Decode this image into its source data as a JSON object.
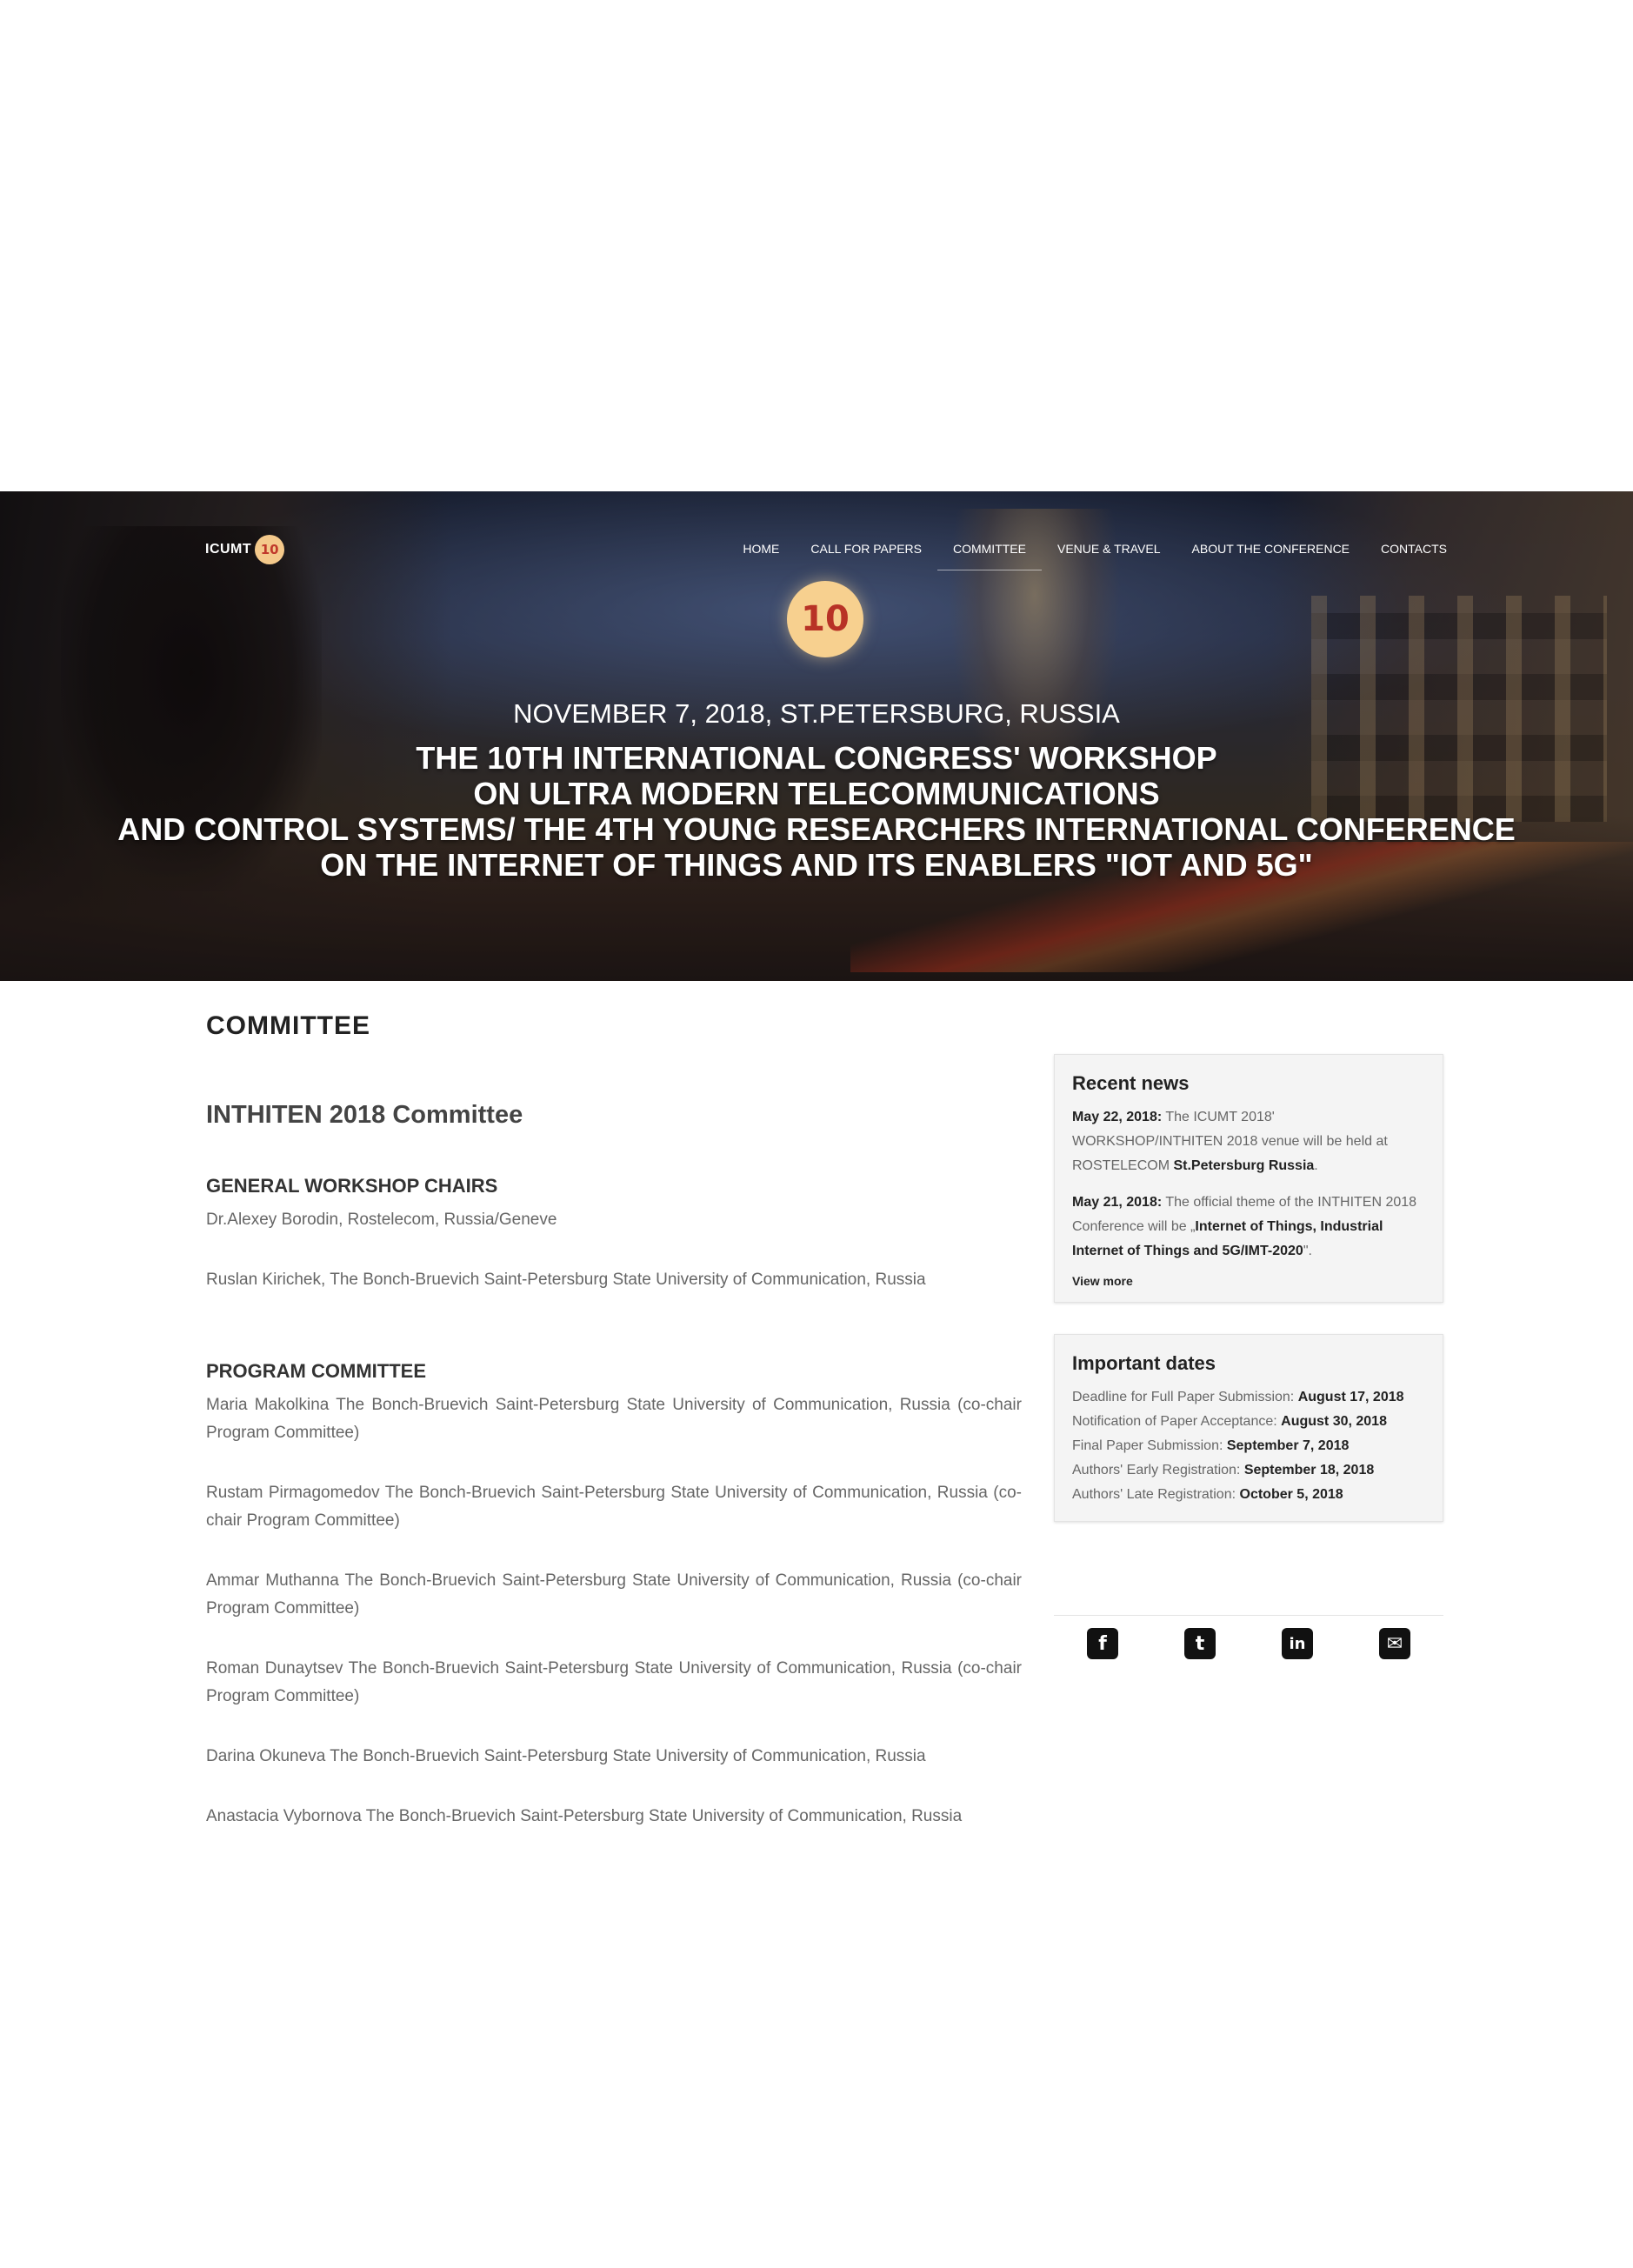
{
  "header": {
    "logo_text": "ICUMT",
    "logo_badge": "10",
    "nav": [
      {
        "label": "HOME"
      },
      {
        "label": "CALL FOR PAPERS"
      },
      {
        "label": "COMMITTEE"
      },
      {
        "label": "VENUE & TRAVEL"
      },
      {
        "label": "ABOUT THE CONFERENCE"
      },
      {
        "label": "CONTACTS"
      }
    ],
    "active_nav": "COMMITTEE"
  },
  "hero": {
    "badge": "10",
    "date": "NOVEMBER 7, 2018, ST.PETERSBURG, RUSSIA",
    "title_lines": [
      "THE 10TH INTERNATIONAL CONGRESS' WORKSHOP",
      "ON ULTRA MODERN TELECOMMUNICATIONS",
      "AND CONTROL SYSTEMS/ THE 4TH YOUNG RESEARCHERS INTERNATIONAL CONFERENCE",
      "ON THE INTERNET OF THINGS AND ITS ENABLERS \"IOT AND 5G\""
    ]
  },
  "page": {
    "heading": "COMMITTEE",
    "committee_title": "INTHITEN 2018 Committee",
    "sections": [
      {
        "title": "GENERAL WORKSHOP CHAIRS",
        "members": [
          "Dr.Alexey Borodin, Rostelecom, Russia/Geneve",
          "Ruslan Kirichek, The Bonch-Bruevich Saint-Petersburg State University of Communication, Russia"
        ]
      },
      {
        "title": "PROGRAM COMMITTEE",
        "members": [
          "Maria Makolkina The Bonch-Bruevich Saint-Petersburg State University of Communication, Russia (co-chair Program Committee)",
          "Rustam Pirmagomedov The Bonch-Bruevich Saint-Petersburg State University of Communication, Russia (co-chair Program Committee)",
          "Ammar Muthanna The Bonch-Bruevich Saint-Petersburg State University of Communication, Russia (co-chair Program Committee)",
          "Roman Dunaytsev The Bonch-Bruevich Saint-Petersburg State University of Communication, Russia (co-chair Program Committee)",
          "Darina Okuneva The Bonch-Bruevich Saint-Petersburg State University of Communication, Russia",
          "Anastacia Vybornova The Bonch-Bruevich Saint-Petersburg State University of Communication, Russia"
        ]
      }
    ]
  },
  "sidebar": {
    "recent_news": {
      "title": "Recent news",
      "items": [
        {
          "date": "May 22, 2018:",
          "text": " The ICUMT 2018' WORKSHOP/INTHITEN 2018 venue will be held at ROSTELECOM ",
          "bold": "St.Petersburg Russia",
          "tail": "."
        },
        {
          "date": "May 21, 2018:",
          "text": " The official theme of the INTHITEN 2018 Conference will be „",
          "bold": "Internet of Things, Industrial Internet of Things and 5G/IMT-2020",
          "tail": "\"."
        }
      ],
      "view_more": "View more"
    },
    "important_dates": {
      "title": "Important dates",
      "rows": [
        {
          "label": "Deadline for Full Paper Submission: ",
          "date": "August 17, 2018"
        },
        {
          "label": "Notification of Paper Acceptance: ",
          "date": "August 30, 2018"
        },
        {
          "label": "Final Paper Submission: ",
          "date": "September 7, 2018"
        },
        {
          "label": "Authors' Early Registration: ",
          "date": "September 18, 2018"
        },
        {
          "label": "Authors' Late Registration: ",
          "date": "October 5, 2018"
        }
      ]
    },
    "social": [
      {
        "icon": "facebook-icon",
        "glyph": "f"
      },
      {
        "icon": "twitter-icon",
        "glyph": "t"
      },
      {
        "icon": "linkedin-icon",
        "glyph": "in"
      },
      {
        "icon": "email-icon",
        "glyph": "✉"
      }
    ]
  }
}
